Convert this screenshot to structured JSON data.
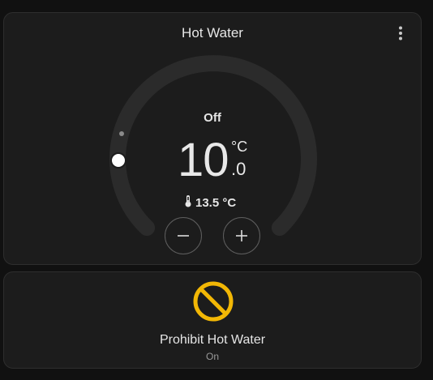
{
  "thermostat": {
    "title": "Hot Water",
    "mode": "Off",
    "target_integer": "10",
    "target_decimal": ".0",
    "target_unit": "°C",
    "current_temperature": "13.5 °C",
    "icons": {
      "menu": "more-vertical-icon",
      "current": "thermometer-icon",
      "decrease": "minus-icon",
      "increase": "plus-icon"
    }
  },
  "prohibit": {
    "name": "Prohibit Hot Water",
    "state": "On",
    "icon": "prohibit-icon",
    "icon_color": "#f2b705"
  },
  "colors": {
    "background": "#111111",
    "card": "#1c1c1c",
    "dial_track": "#2b2b2b",
    "slider_handle": "#ffffff"
  }
}
